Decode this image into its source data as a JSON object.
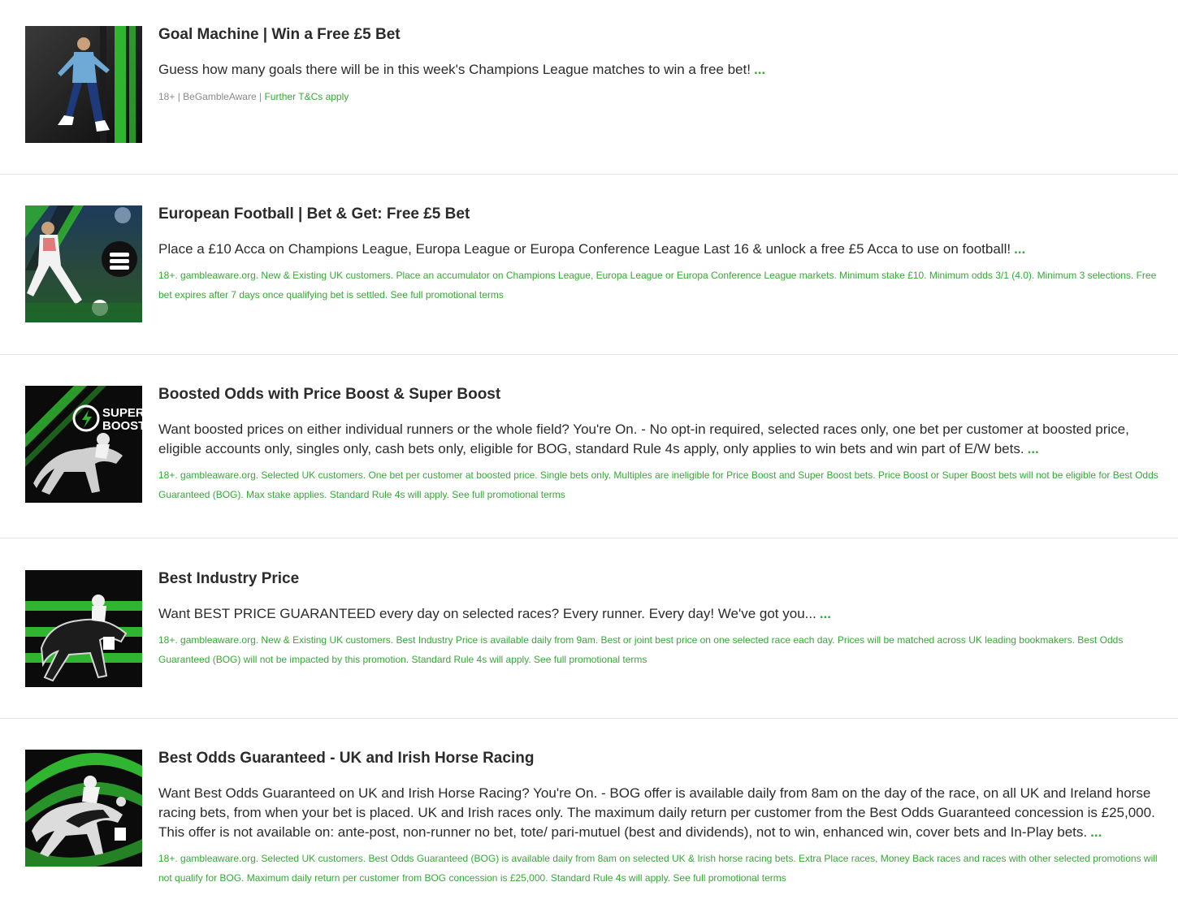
{
  "promos": [
    {
      "title": "Goal Machine | Win a Free £5 Bet",
      "description": "Guess how many goals there will be in this week's Champions League matches to win a free bet!",
      "more": "...",
      "terms_age": "18+",
      "terms_sep1": " | ",
      "terms_aware": "BeGambleAware",
      "terms_sep2": " | ",
      "terms_link": "Further T&Cs apply",
      "image_icon": "footballer-celebrating-image"
    },
    {
      "title": "European Football | Bet & Get: Free £5 Bet",
      "description": "Place a £10 Acca on Champions League, Europa League or Europa Conference League Last 16 & unlock a free £5 Acca to use on football!",
      "more": "...",
      "terms": "18+. gambleaware.org. New & Existing UK customers. Place an accumulator on Champions League, Europa League or Europa Conference League markets. Minimum stake £10. Minimum odds 3/1 (4.0). Minimum 3 selections. Free bet expires after 7 days once qualifying bet is settled.",
      "terms_link": "See full promotional terms",
      "image_icon": "footballer-kicking-image"
    },
    {
      "title": "Boosted Odds with Price Boost & Super Boost",
      "description": "Want boosted prices on either individual runners or the whole field? You're On. - No opt-in required, selected races only, one bet per customer at boosted price, eligible accounts only, singles only, cash bets only, eligible for BOG, standard Rule 4s apply, only applies to win bets and win part of E/W bets.",
      "more": "...",
      "terms": "18+. gambleaware.org. Selected UK customers. One bet per customer at boosted price. Single bets only. Multiples are ineligible for Price Boost and Super Boost bets. Price Boost or Super Boost bets will not be eligible for Best Odds Guaranteed (BOG). Max stake applies. Standard Rule 4s will apply.",
      "terms_link": "See full promotional terms",
      "image_icon": "super-boost-horse-image",
      "badge_line1": "SUPER",
      "badge_line2": "BOOST"
    },
    {
      "title": "Best Industry Price",
      "description": "Want BEST PRICE GUARANTEED every day on selected races? Every runner. Every day! We've got you...",
      "more": "...",
      "terms": "18+. gambleaware.org. New & Existing UK customers. Best Industry Price is available daily from 9am. Best or joint best price on one selected race each day. Prices will be matched across UK leading bookmakers. Best Odds Guaranteed (BOG) will not be impacted by this promotion. Standard Rule 4s will apply.",
      "terms_link": "See full promotional terms",
      "image_icon": "racehorse-image"
    },
    {
      "title": "Best Odds Guaranteed - UK and Irish Horse Racing",
      "description": "Want Best Odds Guaranteed on UK and Irish Horse Racing? You're On. - BOG offer is available daily from 8am on the day of the race, on all UK and Ireland horse racing bets, from when your bet is placed. UK and Irish races only. The maximum daily return per customer from the Best Odds Guaranteed concession is £25,000. This offer is not available on: ante-post, non-runner no bet, tote/ pari-mutuel (best and dividends), not to win, enhanced win, cover bets and In-Play bets.",
      "more": "...",
      "terms": "18+. gambleaware.org. Selected UK customers. Best Odds Guaranteed (BOG) is available daily from 8am on selected UK & Irish horse racing bets. Extra Place races, Money Back races and races with other selected promotions will not qualify for BOG. Maximum daily return per customer from BOG concession is £25,000. Standard Rule 4s will apply.",
      "terms_link": "See full promotional terms",
      "image_icon": "horse-race-image"
    }
  ],
  "colors": {
    "accent_green": "#36a836",
    "text": "#2b2b2b",
    "muted": "#8a8a8a",
    "divider": "#e2e2e2"
  }
}
